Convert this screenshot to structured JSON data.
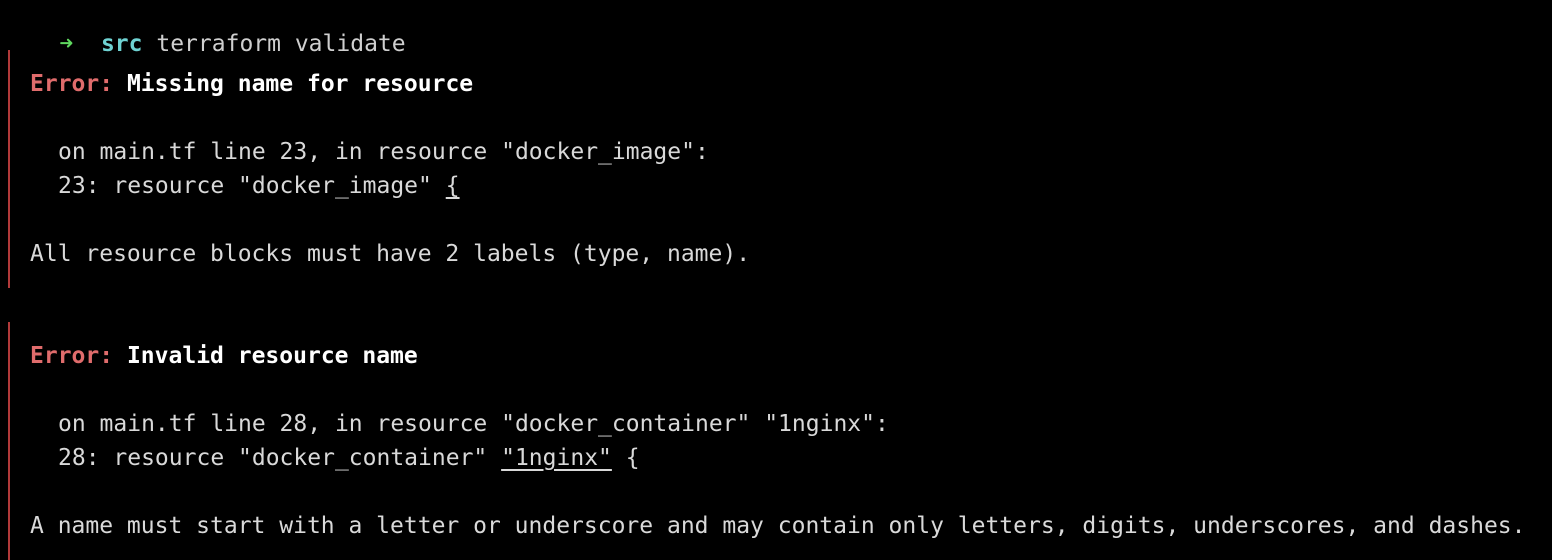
{
  "prompt": {
    "arrow": "➜",
    "directory": "src",
    "command": "terraform validate"
  },
  "errors": [
    {
      "label": "Error:",
      "title": "Missing name for resource",
      "location": "on main.tf line 23, in resource \"docker_image\":",
      "code_prefix": "23: resource \"docker_image\" ",
      "code_highlight": "{",
      "code_suffix": "",
      "detail": "All resource blocks must have 2 labels (type, name)."
    },
    {
      "label": "Error:",
      "title": "Invalid resource name",
      "location": "on main.tf line 28, in resource \"docker_container\" \"1nginx\":",
      "code_prefix": "28: resource \"docker_container\" ",
      "code_highlight": "\"1nginx\"",
      "code_suffix": " {",
      "detail": "A name must start with a letter or underscore and may contain only letters, digits, underscores, and dashes."
    }
  ],
  "colors": {
    "background": "#000000",
    "prompt_arrow": "#5fd75f",
    "prompt_dir": "#6fd3d3",
    "error_label": "#e06c6c",
    "error_gutter": "#b23a3a",
    "text": "#d9d9d9"
  }
}
